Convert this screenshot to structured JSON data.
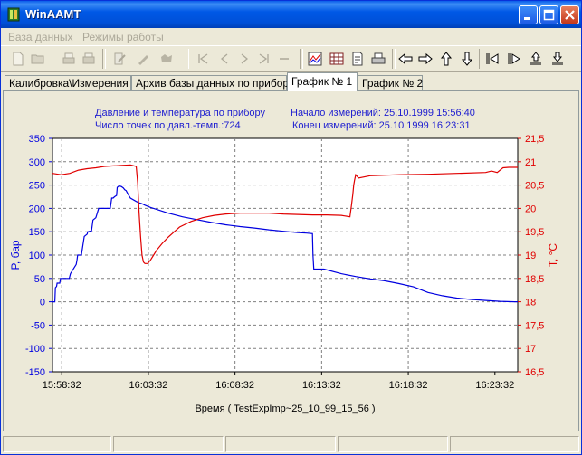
{
  "window": {
    "title": "WinAAMT"
  },
  "menu": [
    "База данных",
    "Режимы работы"
  ],
  "tabs": [
    {
      "label": "Калибровка\\Измерения",
      "active": false
    },
    {
      "label": "Архив базы данных по прибору",
      "active": false
    },
    {
      "label": "График № 1",
      "active": true
    },
    {
      "label": "График № 2",
      "active": false
    }
  ],
  "header": {
    "line1": "Давление и температура по прибору",
    "line2": "Число точек по давл.-темп.:724",
    "start": "Начало измерений: 25.10.1999 15:56:40",
    "end": "Конец  измерений: 25.10.1999 16:23:31"
  },
  "chart_data": {
    "type": "line",
    "xlabel": "Время  ( TestExpImp~25_10_99_15_56 )",
    "ylabel_left": "P, бар",
    "ylabel_right": "T, °C",
    "x_ticks": [
      "15:58:32",
      "16:03:32",
      "16:08:32",
      "16:13:32",
      "16:18:32",
      "16:23:32"
    ],
    "xlim_seconds_from_start": [
      0,
      1611
    ],
    "ylim_left": [
      -150,
      350
    ],
    "y_ticks_left": [
      "350",
      "300",
      "250",
      "200",
      "150",
      "100",
      "50",
      "0",
      "-50",
      "-100",
      "-150"
    ],
    "ylim_right": [
      16.5,
      21.5
    ],
    "y_ticks_right": [
      "21,5",
      "21",
      "20,5",
      "20",
      "19,5",
      "19",
      "18,5",
      "18",
      "17,5",
      "17",
      "16,5"
    ],
    "grid": true,
    "colors": {
      "pressure": "#0000e0",
      "temperature": "#e00000",
      "grid": "#808080",
      "axis_left": "#0000e0",
      "axis_right": "#e00000"
    },
    "series": [
      {
        "axis": "left",
        "x": [
          0,
          8,
          10,
          14,
          16,
          25,
          28,
          58,
          62,
          82,
          85,
          87,
          100,
          110,
          120,
          122,
          135,
          140,
          150,
          160,
          200,
          205,
          210,
          215,
          222,
          224,
          230,
          238,
          245,
          250,
          255,
          262,
          270,
          290,
          300,
          310,
          320,
          340,
          360,
          400,
          450,
          500,
          550,
          600,
          650,
          700,
          750,
          800,
          850,
          880,
          900,
          902,
          905,
          940,
          1000,
          1050,
          1100,
          1150,
          1200,
          1250,
          1300,
          1350,
          1400,
          1450,
          1500,
          1550,
          1600,
          1611
        ],
        "y": [
          0,
          0,
          30,
          33,
          40,
          40,
          50,
          50,
          60,
          80,
          90,
          100,
          100,
          140,
          145,
          150,
          152,
          175,
          180,
          200,
          200,
          222,
          222,
          225,
          228,
          245,
          248,
          247,
          244,
          240,
          238,
          230,
          222,
          215,
          212,
          210,
          207,
          202,
          198,
          190,
          182,
          176,
          170,
          165,
          161,
          158,
          154,
          151,
          148,
          147,
          146,
          100,
          70,
          70,
          60,
          54,
          49,
          45,
          39,
          32,
          20,
          13,
          8,
          5,
          3,
          1,
          0,
          0
        ]
      },
      {
        "axis": "right",
        "x": [
          0,
          30,
          60,
          90,
          120,
          150,
          180,
          210,
          240,
          270,
          290,
          295,
          300,
          305,
          310,
          315,
          320,
          330,
          340,
          350,
          360,
          380,
          400,
          440,
          480,
          520,
          560,
          600,
          650,
          700,
          750,
          800,
          850,
          900,
          950,
          1000,
          1030,
          1035,
          1040,
          1043,
          1046,
          1050,
          1060,
          1100,
          1200,
          1300,
          1400,
          1500,
          1520,
          1540,
          1560,
          1580,
          1611
        ],
        "y": [
          20.75,
          20.72,
          20.75,
          20.82,
          20.85,
          20.87,
          20.9,
          20.91,
          20.92,
          20.93,
          20.9,
          20.55,
          19.9,
          19.4,
          19.0,
          18.85,
          18.82,
          18.82,
          18.9,
          19.0,
          19.1,
          19.25,
          19.38,
          19.6,
          19.72,
          19.8,
          19.85,
          19.88,
          19.9,
          19.9,
          19.9,
          19.88,
          19.87,
          19.86,
          19.86,
          19.85,
          19.82,
          20.05,
          20.3,
          20.5,
          20.6,
          20.72,
          20.65,
          20.7,
          20.72,
          20.73,
          20.75,
          20.77,
          20.8,
          20.77,
          20.87,
          20.88,
          20.88
        ]
      }
    ]
  }
}
